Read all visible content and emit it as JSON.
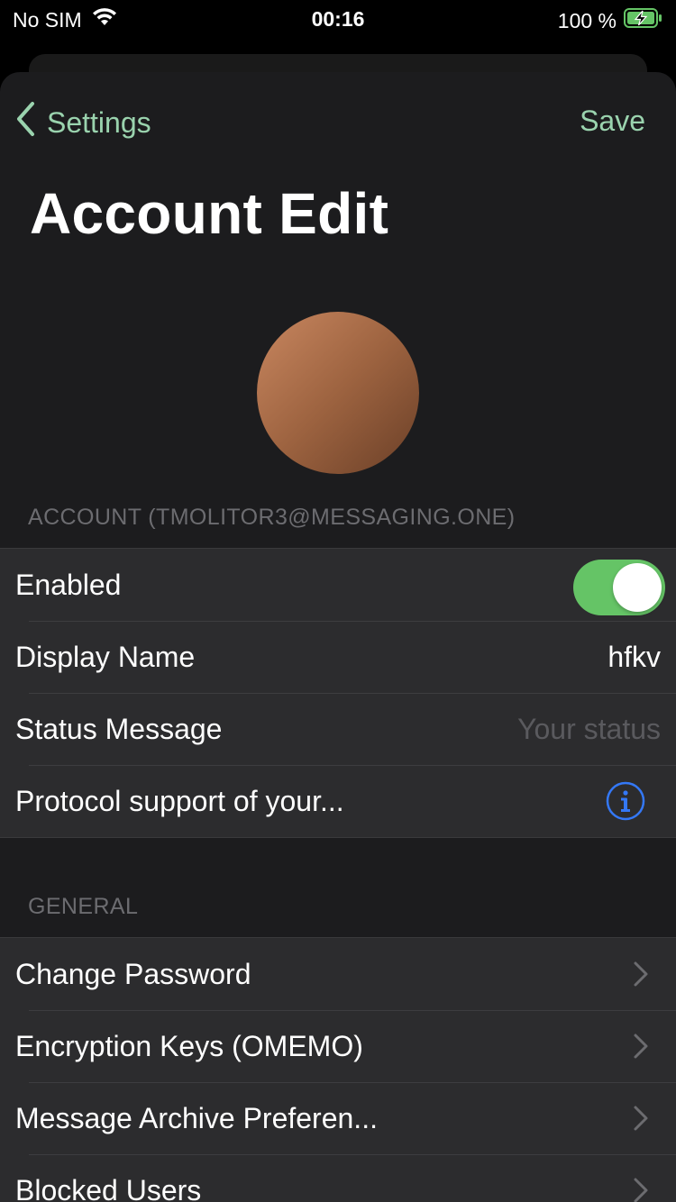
{
  "status_bar": {
    "carrier": "No SIM",
    "time": "00:16",
    "battery": "100 %"
  },
  "nav": {
    "back_label": "Settings",
    "save_label": "Save"
  },
  "page_title": "Account Edit",
  "account_section": {
    "header": "ACCOUNT (TMOLITOR3@MESSAGING.ONE)",
    "enabled_label": "Enabled",
    "enabled_on": true,
    "display_name_label": "Display Name",
    "display_name_value": "hfkv",
    "status_message_label": "Status Message",
    "status_message_placeholder": "Your status",
    "protocol_label": "Protocol support of your..."
  },
  "general_section": {
    "header": "GENERAL",
    "items": [
      {
        "label": "Change Password"
      },
      {
        "label": "Encryption Keys (OMEMO)"
      },
      {
        "label": "Message Archive Preferen..."
      },
      {
        "label": "Blocked Users"
      }
    ]
  },
  "colors": {
    "accent": "#9ad3ae",
    "toggle_on": "#65c466",
    "info_blue": "#3478f6",
    "background": "#1c1c1e",
    "cell": "#2c2c2e"
  },
  "icons": [
    "wifi-icon",
    "battery-charging-icon",
    "back-chevron-icon",
    "info-icon",
    "chevron-right-icon"
  ]
}
